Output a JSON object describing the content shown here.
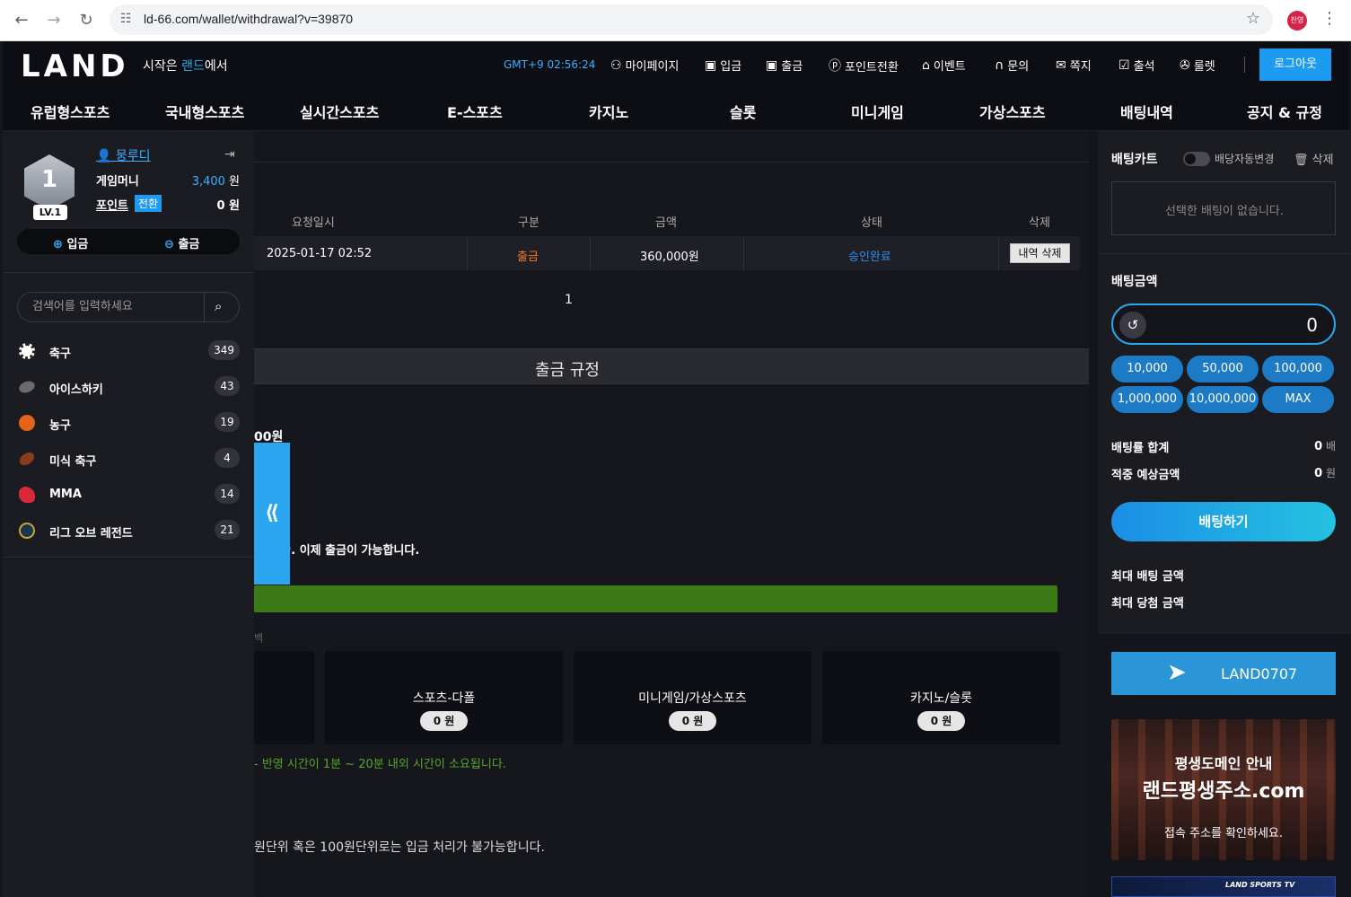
{
  "browser": {
    "url": "ld-66.com/wallet/withdrawal?v=39870",
    "profile_label": "찬영"
  },
  "header": {
    "logo": "LAND",
    "tagline_pre": "시작은 ",
    "tagline_accent": "랜드",
    "tagline_post": "에서",
    "clock": "GMT+9 02:56:24",
    "nav": [
      {
        "label": "마이페이지",
        "icon": "user-icon"
      },
      {
        "label": "입금",
        "icon": "deposit-icon"
      },
      {
        "label": "출금",
        "icon": "withdraw-icon"
      },
      {
        "label": "포인트전환",
        "icon": "point-icon"
      },
      {
        "label": "이벤트",
        "icon": "gift-icon"
      },
      {
        "label": "문의",
        "icon": "headset-icon"
      },
      {
        "label": "쪽지",
        "icon": "mail-icon"
      },
      {
        "label": "출석",
        "icon": "calendar-icon"
      },
      {
        "label": "룰렛",
        "icon": "roulette-icon"
      }
    ],
    "logout": "로그아웃"
  },
  "main_menu": [
    "유럽형스포츠",
    "국내형스포츠",
    "실시간스포츠",
    "E-스포츠",
    "카지노",
    "슬롯",
    "미니게임",
    "가상스포츠",
    "배팅내역",
    "공지 & 규정"
  ],
  "user": {
    "level_num": "1",
    "level": "LV.1",
    "name": "뭉루디",
    "money_label": "게임머니",
    "money": "3,400",
    "money_unit": " 원",
    "point_label": "포인트",
    "convert": "전환",
    "point": "0",
    "point_unit": " 원",
    "deposit": "입금",
    "withdraw": "출금"
  },
  "search": {
    "placeholder": "검색어를 입력하세요"
  },
  "sports": [
    {
      "name": "축구",
      "count": "349",
      "color": "#ffffff"
    },
    {
      "name": "아이스하키",
      "count": "43",
      "color": "#6b6b6b"
    },
    {
      "name": "농구",
      "count": "19",
      "color": "#e2631a"
    },
    {
      "name": "미식 축구",
      "count": "4",
      "color": "#8a3b1c"
    },
    {
      "name": "MMA",
      "count": "14",
      "color": "#d9283a"
    },
    {
      "name": "리그 오브 레전드",
      "count": "21",
      "color": "#c9a43a"
    }
  ],
  "table": {
    "headers": [
      "요청일시",
      "구분",
      "금액",
      "상태",
      "삭제"
    ],
    "rows": [
      {
        "date": "2025-01-17 02:52",
        "type": "출금",
        "amount": "360,000원",
        "status": "승인완료",
        "delete": "내역 삭제"
      }
    ],
    "page": "1"
  },
  "rules": {
    "title": "출금 규정",
    "partial_amount": "00원",
    "message": "ŀ. 이제 출금이 가능합니다.",
    "progress": 1.0,
    "tiny": "백",
    "cards": [
      {
        "name": "스포츠-다폴",
        "value": "0 원"
      },
      {
        "name": "미니게임/가상스포츠",
        "value": "0 원"
      },
      {
        "name": "카지노/슬롯",
        "value": "0 원"
      }
    ],
    "note_green": "- 반영 시간이 1분 ~ 20분 내외 시간이 소요됩니다.",
    "note_bottom": "원단위 혹은 100원단위로는 입금 처리가 불가능합니다."
  },
  "betslip": {
    "title": "배팅카트",
    "auto_label": "배당자동변경",
    "clear": "삭제",
    "empty": "선택한 배팅이 없습니다.",
    "amount_label": "배팅금액",
    "amount": "0",
    "chips": [
      "10,000",
      "50,000",
      "100,000",
      "1,000,000",
      "10,000,000",
      "MAX"
    ],
    "odds_label": "배팅률 합계",
    "odds_value": "0",
    "odds_unit": " 배",
    "win_label": "적중 예상금액",
    "win_value": "0",
    "win_unit": " 원",
    "bet_button": "배팅하기",
    "max_bet": "최대 배팅 금액",
    "max_win": "최대 당첨 금액",
    "telegram": "LAND0707",
    "promo_line1": "평생도메인 안내",
    "promo_line2": "랜드평생주소.com",
    "promo_line3": "접속 주소를 확인하세요.",
    "promo2": "LAND SPORTS TV"
  }
}
